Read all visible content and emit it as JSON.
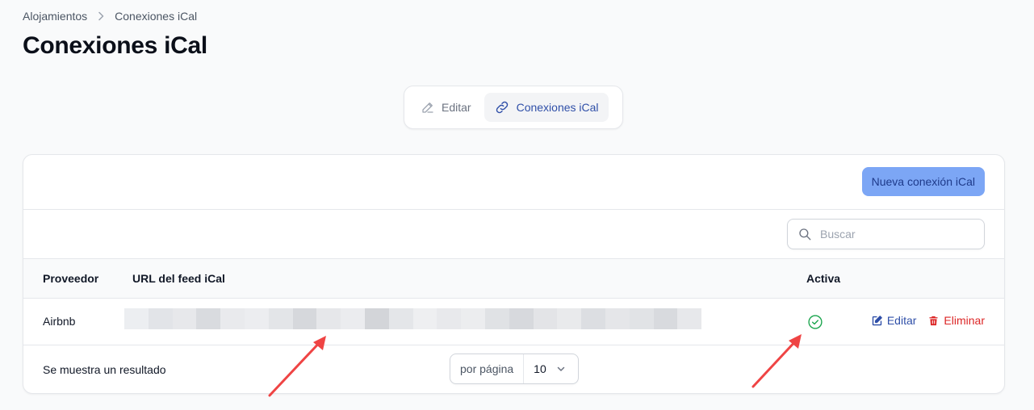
{
  "breadcrumb": {
    "parent": "Alojamientos",
    "current": "Conexiones iCal"
  },
  "page": {
    "title": "Conexiones iCal"
  },
  "tabs": [
    {
      "label": "Editar",
      "icon": "pencil-square-icon",
      "active": false
    },
    {
      "label": "Conexiones iCal",
      "icon": "link-icon",
      "active": true
    }
  ],
  "card": {
    "new_button": "Nueva conexión iCal",
    "search_placeholder": "Buscar",
    "columns": {
      "provider": "Proveedor",
      "url": "URL del feed iCal",
      "active": "Activa"
    },
    "rows": [
      {
        "provider": "Airbnb",
        "url_redacted": true,
        "active": true,
        "edit": "Editar",
        "delete": "Eliminar"
      }
    ],
    "footer": {
      "results_text": "Se muestra un resultado",
      "per_page_label": "por página",
      "per_page_value": "10"
    }
  },
  "colors": {
    "accent": "#2f4fa8",
    "button_bg": "#7ca6f5",
    "success": "#16a34a",
    "danger": "#dc2626",
    "annotation_arrow": "#ef4444"
  }
}
